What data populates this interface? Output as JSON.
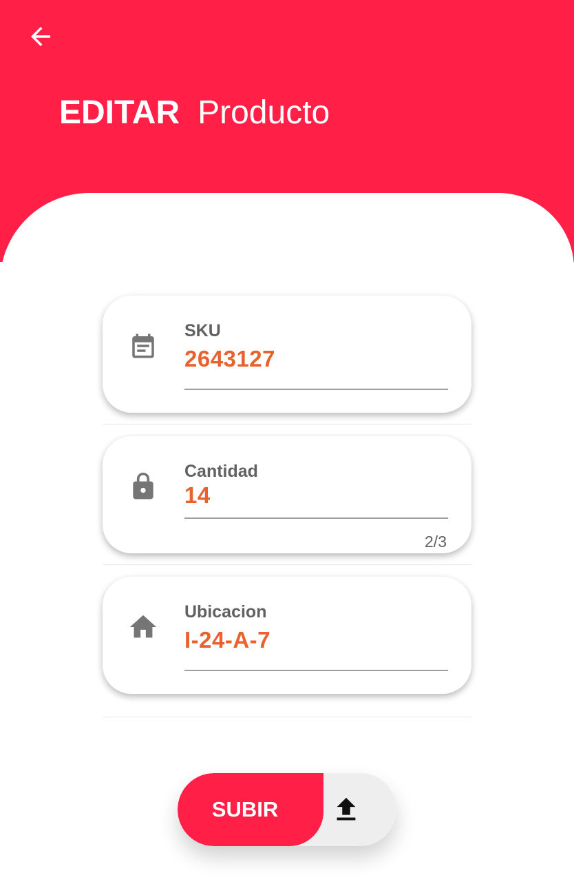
{
  "header": {
    "back_icon": "arrow-left-icon",
    "title_bold": "EDITAR",
    "title_regular": "Producto",
    "color": "#ff1f47"
  },
  "fields": [
    {
      "icon": "calendar-note-icon",
      "label": "SKU",
      "value": "2643127"
    },
    {
      "icon": "lock-icon",
      "label": "Cantidad",
      "value": "14",
      "counter": "2/3"
    },
    {
      "icon": "home-icon",
      "label": "Ubicacion",
      "value": "I-24-A-7"
    }
  ],
  "upload_button": {
    "label": "SUBIR",
    "icon": "upload-icon"
  },
  "colors": {
    "accent": "#ff1f47",
    "value_text": "#e8622e",
    "label_text": "#616161"
  }
}
